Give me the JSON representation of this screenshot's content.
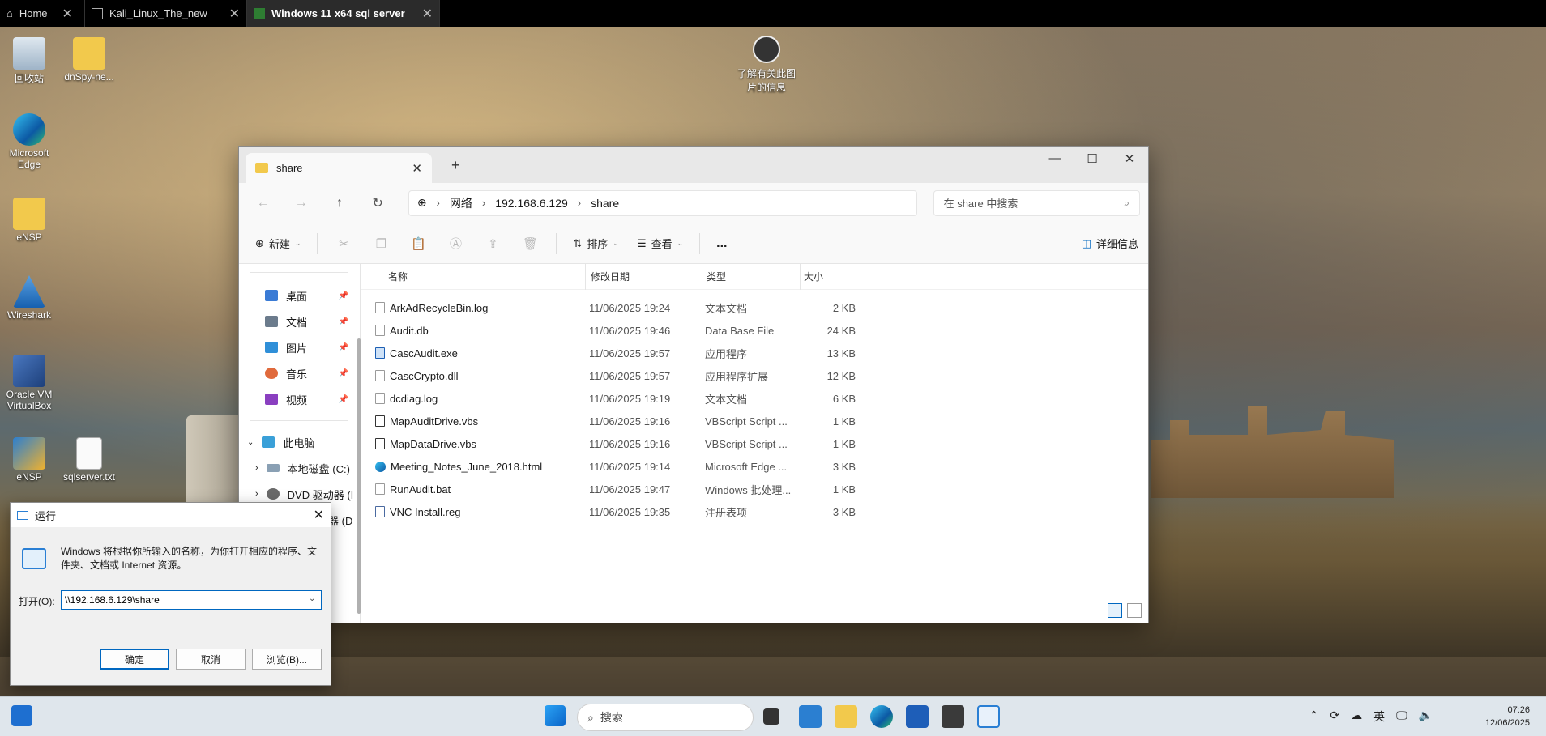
{
  "vm_tabs": [
    {
      "label": "Home"
    },
    {
      "label": "Kali_Linux_The_new"
    },
    {
      "label": "Windows 11 x64 sql server"
    }
  ],
  "desktop_icons": [
    {
      "label": "回收站"
    },
    {
      "label": "dnSpy-ne..."
    },
    {
      "label": "Microsoft Edge"
    },
    {
      "label": "eNSP"
    },
    {
      "label": "Wireshark"
    },
    {
      "label": "Oracle VM VirtualBox"
    },
    {
      "label": "eNSP"
    },
    {
      "label": "sqlserver.txt"
    }
  ],
  "info_icon_label": "了解有关此图片的信息",
  "explorer": {
    "tab_title": "share",
    "address": {
      "root": "网络",
      "host": "192.168.6.129",
      "folder": "share"
    },
    "search_placeholder": "在 share 中搜索",
    "commands": {
      "new": "新建",
      "sort": "排序",
      "view": "查看",
      "more": "...",
      "details": "详细信息"
    },
    "nav_items": [
      {
        "label": "桌面",
        "color": "#3a7bd5"
      },
      {
        "label": "文档",
        "color": "#6b7b8c"
      },
      {
        "label": "图片",
        "color": "#2f8fd8"
      },
      {
        "label": "音乐",
        "color": "#e06a3c"
      },
      {
        "label": "视频",
        "color": "#8a3fc0"
      }
    ],
    "this_pc": "此电脑",
    "local_disk": "本地磁盘 (C:)",
    "dvd": "DVD 驱动器 (I",
    "partial_item": "器 (D",
    "columns": {
      "name": "名称",
      "date": "修改日期",
      "type": "类型",
      "size": "大小"
    },
    "files": [
      {
        "name": "ArkAdRecycleBin.log",
        "date": "11/06/2025 19:24",
        "type": "文本文档",
        "size": "2 KB"
      },
      {
        "name": "Audit.db",
        "date": "11/06/2025 19:46",
        "type": "Data Base File",
        "size": "24 KB"
      },
      {
        "name": "CascAudit.exe",
        "date": "11/06/2025 19:57",
        "type": "应用程序",
        "size": "13 KB"
      },
      {
        "name": "CascCrypto.dll",
        "date": "11/06/2025 19:57",
        "type": "应用程序扩展",
        "size": "12 KB"
      },
      {
        "name": "dcdiag.log",
        "date": "11/06/2025 19:19",
        "type": "文本文档",
        "size": "6 KB"
      },
      {
        "name": "MapAuditDrive.vbs",
        "date": "11/06/2025 19:16",
        "type": "VBScript Script ...",
        "size": "1 KB"
      },
      {
        "name": "MapDataDrive.vbs",
        "date": "11/06/2025 19:16",
        "type": "VBScript Script ...",
        "size": "1 KB"
      },
      {
        "name": "Meeting_Notes_June_2018.html",
        "date": "11/06/2025 19:14",
        "type": "Microsoft Edge ...",
        "size": "3 KB"
      },
      {
        "name": "RunAudit.bat",
        "date": "11/06/2025 19:47",
        "type": "Windows 批处理...",
        "size": "1 KB"
      },
      {
        "name": "VNC Install.reg",
        "date": "11/06/2025 19:35",
        "type": "注册表项",
        "size": "3 KB"
      }
    ]
  },
  "run_dialog": {
    "title": "运行",
    "description": "Windows 将根据你所输入的名称，为你打开相应的程序、文件夹、文档或 Internet 资源。",
    "open_label": "打开(O):",
    "input_value": "\\\\192.168.6.129\\share",
    "ok": "确定",
    "cancel": "取消",
    "browse": "浏览(B)..."
  },
  "taskbar": {
    "search_placeholder": "搜索",
    "ime": "英",
    "time": "07:26",
    "date": "12/06/2025"
  }
}
